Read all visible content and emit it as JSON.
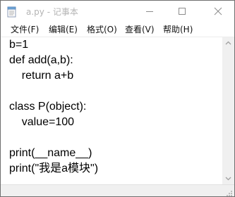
{
  "window": {
    "title": "a.py - 记事本"
  },
  "menu": {
    "items": [
      {
        "label": "文件(F)"
      },
      {
        "label": "编辑(E)"
      },
      {
        "label": "格式(O)"
      },
      {
        "label": "查看(V)"
      },
      {
        "label": "帮助(H)"
      }
    ]
  },
  "editor": {
    "lines": [
      "b=1",
      "def add(a,b):",
      "    return a+b",
      "",
      "class P(object):",
      "    value=100",
      "",
      "print(__name__)",
      "print(\"我是a模块\")"
    ]
  },
  "icons": {
    "app": "notepad-icon",
    "minimize": "minimize-icon",
    "maximize": "maximize-icon",
    "close": "close-icon",
    "scroll_up": "scroll-up-arrow-icon",
    "scroll_down": "scroll-down-arrow-icon",
    "size_grip": "size-grip-icon"
  },
  "colors": {
    "title_text": "#b4b4b4",
    "text": "#000000",
    "scrollbar": "#f0f0f0"
  }
}
